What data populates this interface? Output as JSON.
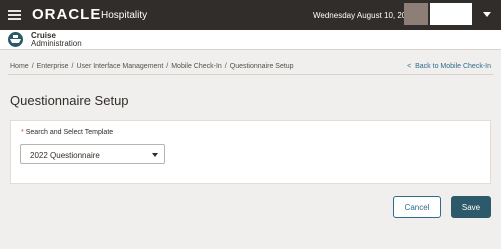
{
  "header": {
    "logo": "ORACLE",
    "logo_sub": "Hospitality",
    "date": "Wednesday August 10, 2022",
    "user_name": ""
  },
  "app": {
    "title": "Cruise",
    "subtitle": "Administration"
  },
  "breadcrumb": {
    "items": [
      "Home",
      "Enterprise",
      "User Interface Management",
      "Mobile Check-In",
      "Questionnaire Setup"
    ],
    "back_link": "Back to Mobile Check-In"
  },
  "page": {
    "title": "Questionnaire Setup"
  },
  "form": {
    "template_label": "Search and Select Template",
    "required_marker": "*",
    "template_value": "2022 Questionnaire"
  },
  "actions": {
    "cancel": "Cancel",
    "save": "Save"
  },
  "colors": {
    "header_bg": "#312d2a",
    "accent": "#2c6c8d",
    "save_bg": "#2c5a6a",
    "required": "#c74634"
  }
}
